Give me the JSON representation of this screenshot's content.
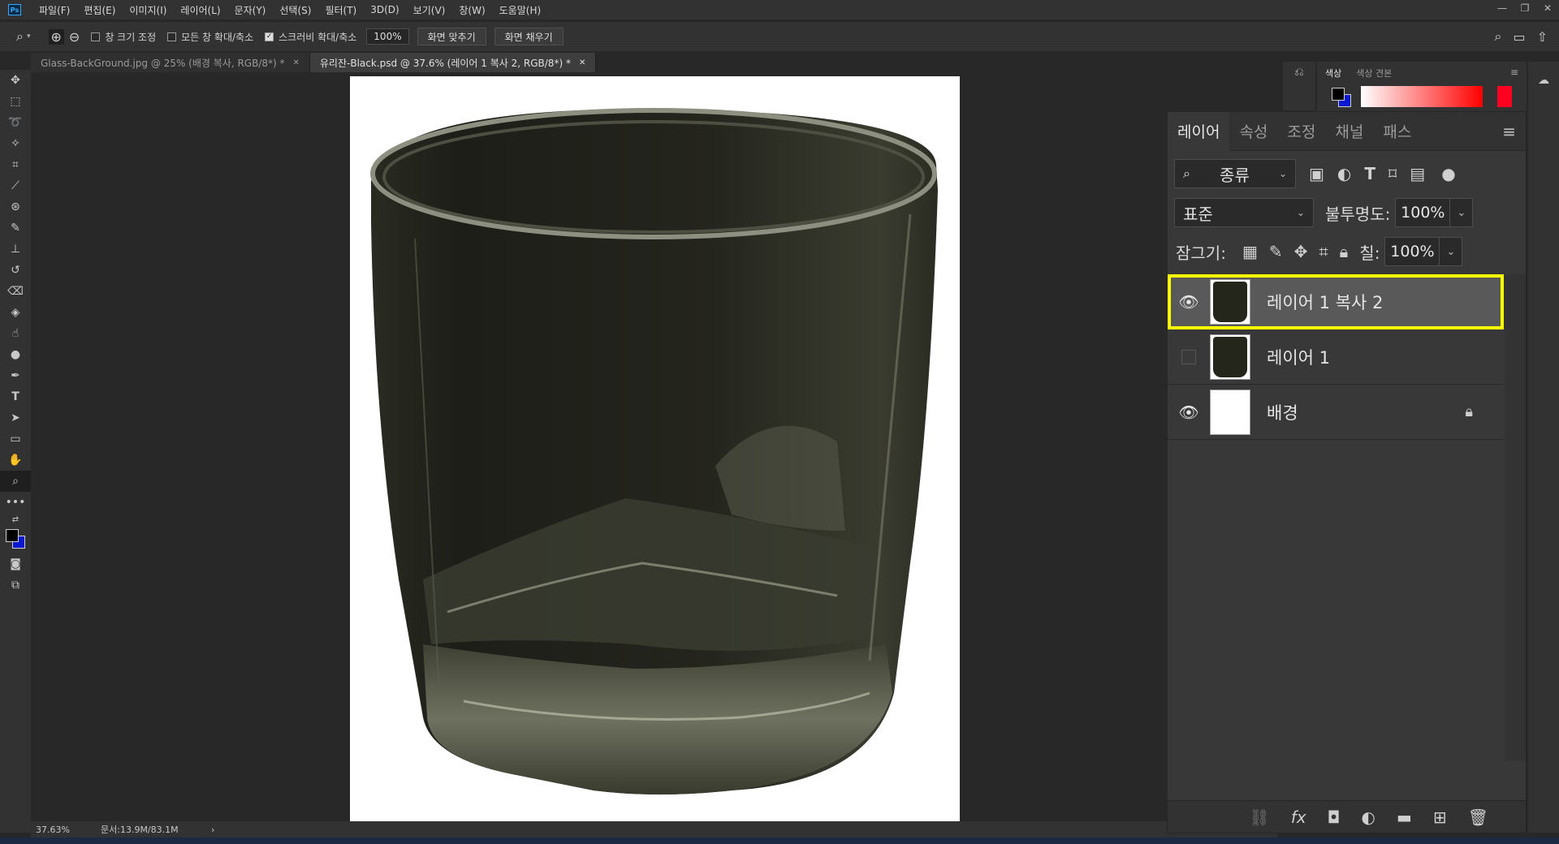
{
  "app": {
    "logo_text": "Ps",
    "menu": [
      "파일(F)",
      "편집(E)",
      "이미지(I)",
      "레이어(L)",
      "문자(Y)",
      "선택(S)",
      "필터(T)",
      "3D(D)",
      "보기(V)",
      "창(W)",
      "도움말(H)"
    ],
    "window_controls": [
      "—",
      "❐",
      "✕"
    ]
  },
  "options": {
    "zoom_icon": "magnifier-icon",
    "resize_windows": {
      "label": "창 크기 조정",
      "checked": false
    },
    "zoom_all_windows": {
      "label": "모든 창 확대/축소",
      "checked": false
    },
    "scrubby_zoom": {
      "label": "스크러비 확대/축소",
      "checked": true
    },
    "zoom_value": "100%",
    "fit_screen": "화면 맞추기",
    "fill_screen": "화면 채우기"
  },
  "tabs": [
    {
      "title": "Glass-BackGround.jpg @ 25% (배경 복사, RGB/8*) *",
      "active": false
    },
    {
      "title": "유리잔-Black.psd @ 37.6% (레이어 1 복사 2, RGB/8*) *",
      "active": true
    }
  ],
  "status": {
    "zoom": "37.63%",
    "doc": "문서:13.9M/83.1M",
    "arrow": "›"
  },
  "color_panel": {
    "tabs": [
      "색상",
      "색상 견본"
    ],
    "active_tab": "색상",
    "fg_color": "#000000",
    "bg_color": "#0a18d2",
    "ramp_color": "#ff0000"
  },
  "layers_panel": {
    "tabs": [
      "레이어",
      "속성",
      "조정",
      "채널",
      "패스"
    ],
    "active_tab": "레이어",
    "filter_kind": "종류",
    "blend_mode": "표준",
    "opacity_label": "불투명도:",
    "opacity_value": "100%",
    "lock_label": "잠그기:",
    "fill_label": "칠:",
    "fill_value": "100%",
    "layers": [
      {
        "name": "레이어 1 복사 2",
        "visible": true,
        "selected": true,
        "thumb": "glass",
        "locked": false
      },
      {
        "name": "레이어 1",
        "visible": false,
        "selected": false,
        "thumb": "glass",
        "locked": false
      },
      {
        "name": "배경",
        "visible": true,
        "selected": false,
        "thumb": "white",
        "locked": true
      }
    ],
    "highlight_color": "#ffff00"
  }
}
